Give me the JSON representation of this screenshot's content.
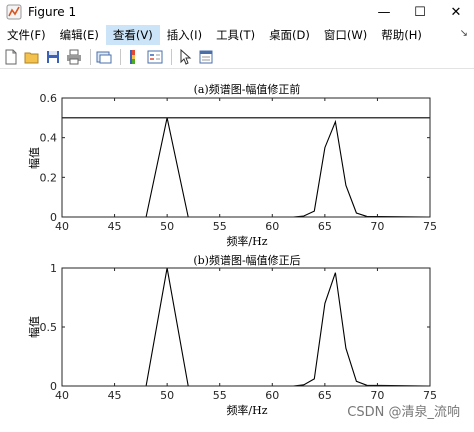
{
  "window": {
    "title": "Figure 1",
    "minimize_label": "—",
    "maximize_label": "☐",
    "close_label": "✕"
  },
  "menu": [
    {
      "label": "文件(F)"
    },
    {
      "label": "编辑(E)"
    },
    {
      "label": "查看(V)"
    },
    {
      "label": "插入(I)"
    },
    {
      "label": "工具(T)"
    },
    {
      "label": "桌面(D)"
    },
    {
      "label": "窗口(W)"
    },
    {
      "label": "帮助(H)"
    }
  ],
  "toolbar_icons": [
    "new-figure-icon",
    "open-file-icon",
    "save-icon",
    "print-icon",
    "link-plot-icon",
    "insert-colorbar-icon",
    "insert-legend-icon",
    "edit-plot-arrow-icon",
    "property-editor-icon"
  ],
  "watermark": "CSDN @清泉_流响",
  "chart_data": [
    {
      "type": "line",
      "title": "(a)频谱图-幅值修正前",
      "xlabel": "频率/Hz",
      "ylabel": "幅值",
      "xlim": [
        40,
        75
      ],
      "ylim": [
        0,
        0.6
      ],
      "xticks": [
        40,
        45,
        50,
        55,
        60,
        65,
        70,
        75
      ],
      "xtick_labels": [
        "40",
        "45",
        "50",
        "55",
        "60",
        "65",
        "70",
        "75"
      ],
      "yticks": [
        0,
        0.2,
        0.4,
        0.6
      ],
      "ytick_labels": [
        "0",
        "0.2",
        "0.4",
        "0.6"
      ],
      "reference_line": 0.5,
      "series": [
        {
          "x": [
            40,
            48,
            50,
            52,
            62,
            63,
            64,
            65,
            66,
            67,
            68,
            69,
            75
          ],
          "y": [
            0,
            0,
            0.5,
            0,
            0,
            0.005,
            0.03,
            0.35,
            0.48,
            0.16,
            0.02,
            0.003,
            0
          ]
        }
      ]
    },
    {
      "type": "line",
      "title": "(b)频谱图-幅值修正后",
      "xlabel": "频率/Hz",
      "ylabel": "幅值",
      "xlim": [
        40,
        75
      ],
      "ylim": [
        0,
        1
      ],
      "xticks": [
        40,
        45,
        50,
        55,
        60,
        65,
        70,
        75
      ],
      "xtick_labels": [
        "40",
        "45",
        "50",
        "55",
        "60",
        "65",
        "70",
        "75"
      ],
      "yticks": [
        0,
        0.5,
        1
      ],
      "ytick_labels": [
        "0",
        "0.5",
        "1"
      ],
      "series": [
        {
          "x": [
            40,
            48,
            50,
            52,
            62,
            63,
            64,
            65,
            66,
            67,
            68,
            69,
            75
          ],
          "y": [
            0,
            0,
            1,
            0,
            0,
            0.01,
            0.06,
            0.7,
            0.96,
            0.32,
            0.04,
            0.006,
            0
          ]
        }
      ]
    }
  ]
}
